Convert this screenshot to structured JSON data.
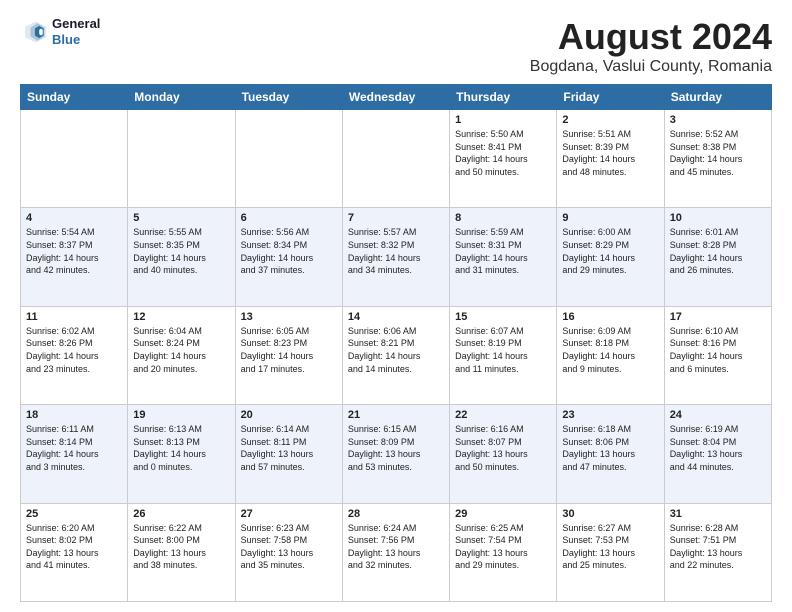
{
  "logo": {
    "line1": "General",
    "line2": "Blue"
  },
  "title": "August 2024",
  "subtitle": "Bogdana, Vaslui County, Romania",
  "weekdays": [
    "Sunday",
    "Monday",
    "Tuesday",
    "Wednesday",
    "Thursday",
    "Friday",
    "Saturday"
  ],
  "weeks": [
    [
      {
        "day": "",
        "info": ""
      },
      {
        "day": "",
        "info": ""
      },
      {
        "day": "",
        "info": ""
      },
      {
        "day": "",
        "info": ""
      },
      {
        "day": "1",
        "info": "Sunrise: 5:50 AM\nSunset: 8:41 PM\nDaylight: 14 hours\nand 50 minutes."
      },
      {
        "day": "2",
        "info": "Sunrise: 5:51 AM\nSunset: 8:39 PM\nDaylight: 14 hours\nand 48 minutes."
      },
      {
        "day": "3",
        "info": "Sunrise: 5:52 AM\nSunset: 8:38 PM\nDaylight: 14 hours\nand 45 minutes."
      }
    ],
    [
      {
        "day": "4",
        "info": "Sunrise: 5:54 AM\nSunset: 8:37 PM\nDaylight: 14 hours\nand 42 minutes."
      },
      {
        "day": "5",
        "info": "Sunrise: 5:55 AM\nSunset: 8:35 PM\nDaylight: 14 hours\nand 40 minutes."
      },
      {
        "day": "6",
        "info": "Sunrise: 5:56 AM\nSunset: 8:34 PM\nDaylight: 14 hours\nand 37 minutes."
      },
      {
        "day": "7",
        "info": "Sunrise: 5:57 AM\nSunset: 8:32 PM\nDaylight: 14 hours\nand 34 minutes."
      },
      {
        "day": "8",
        "info": "Sunrise: 5:59 AM\nSunset: 8:31 PM\nDaylight: 14 hours\nand 31 minutes."
      },
      {
        "day": "9",
        "info": "Sunrise: 6:00 AM\nSunset: 8:29 PM\nDaylight: 14 hours\nand 29 minutes."
      },
      {
        "day": "10",
        "info": "Sunrise: 6:01 AM\nSunset: 8:28 PM\nDaylight: 14 hours\nand 26 minutes."
      }
    ],
    [
      {
        "day": "11",
        "info": "Sunrise: 6:02 AM\nSunset: 8:26 PM\nDaylight: 14 hours\nand 23 minutes."
      },
      {
        "day": "12",
        "info": "Sunrise: 6:04 AM\nSunset: 8:24 PM\nDaylight: 14 hours\nand 20 minutes."
      },
      {
        "day": "13",
        "info": "Sunrise: 6:05 AM\nSunset: 8:23 PM\nDaylight: 14 hours\nand 17 minutes."
      },
      {
        "day": "14",
        "info": "Sunrise: 6:06 AM\nSunset: 8:21 PM\nDaylight: 14 hours\nand 14 minutes."
      },
      {
        "day": "15",
        "info": "Sunrise: 6:07 AM\nSunset: 8:19 PM\nDaylight: 14 hours\nand 11 minutes."
      },
      {
        "day": "16",
        "info": "Sunrise: 6:09 AM\nSunset: 8:18 PM\nDaylight: 14 hours\nand 9 minutes."
      },
      {
        "day": "17",
        "info": "Sunrise: 6:10 AM\nSunset: 8:16 PM\nDaylight: 14 hours\nand 6 minutes."
      }
    ],
    [
      {
        "day": "18",
        "info": "Sunrise: 6:11 AM\nSunset: 8:14 PM\nDaylight: 14 hours\nand 3 minutes."
      },
      {
        "day": "19",
        "info": "Sunrise: 6:13 AM\nSunset: 8:13 PM\nDaylight: 14 hours\nand 0 minutes."
      },
      {
        "day": "20",
        "info": "Sunrise: 6:14 AM\nSunset: 8:11 PM\nDaylight: 13 hours\nand 57 minutes."
      },
      {
        "day": "21",
        "info": "Sunrise: 6:15 AM\nSunset: 8:09 PM\nDaylight: 13 hours\nand 53 minutes."
      },
      {
        "day": "22",
        "info": "Sunrise: 6:16 AM\nSunset: 8:07 PM\nDaylight: 13 hours\nand 50 minutes."
      },
      {
        "day": "23",
        "info": "Sunrise: 6:18 AM\nSunset: 8:06 PM\nDaylight: 13 hours\nand 47 minutes."
      },
      {
        "day": "24",
        "info": "Sunrise: 6:19 AM\nSunset: 8:04 PM\nDaylight: 13 hours\nand 44 minutes."
      }
    ],
    [
      {
        "day": "25",
        "info": "Sunrise: 6:20 AM\nSunset: 8:02 PM\nDaylight: 13 hours\nand 41 minutes."
      },
      {
        "day": "26",
        "info": "Sunrise: 6:22 AM\nSunset: 8:00 PM\nDaylight: 13 hours\nand 38 minutes."
      },
      {
        "day": "27",
        "info": "Sunrise: 6:23 AM\nSunset: 7:58 PM\nDaylight: 13 hours\nand 35 minutes."
      },
      {
        "day": "28",
        "info": "Sunrise: 6:24 AM\nSunset: 7:56 PM\nDaylight: 13 hours\nand 32 minutes."
      },
      {
        "day": "29",
        "info": "Sunrise: 6:25 AM\nSunset: 7:54 PM\nDaylight: 13 hours\nand 29 minutes."
      },
      {
        "day": "30",
        "info": "Sunrise: 6:27 AM\nSunset: 7:53 PM\nDaylight: 13 hours\nand 25 minutes."
      },
      {
        "day": "31",
        "info": "Sunrise: 6:28 AM\nSunset: 7:51 PM\nDaylight: 13 hours\nand 22 minutes."
      }
    ]
  ]
}
